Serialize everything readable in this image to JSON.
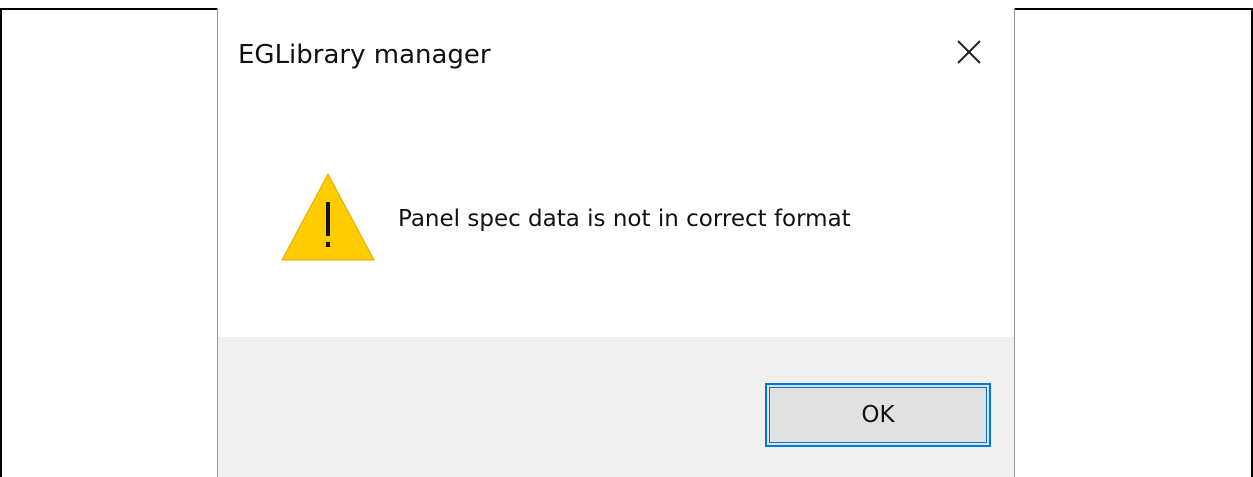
{
  "dialog": {
    "title": "EGLibrary manager",
    "message": "Panel spec data is not in correct format",
    "ok_label": "OK",
    "icon": "warning-icon",
    "close_icon": "close-icon"
  },
  "colors": {
    "accent": "#0078d7",
    "footer_bg": "#f0f0f0",
    "button_bg": "#e1e1e1",
    "warning_fill": "#ffcc00"
  }
}
